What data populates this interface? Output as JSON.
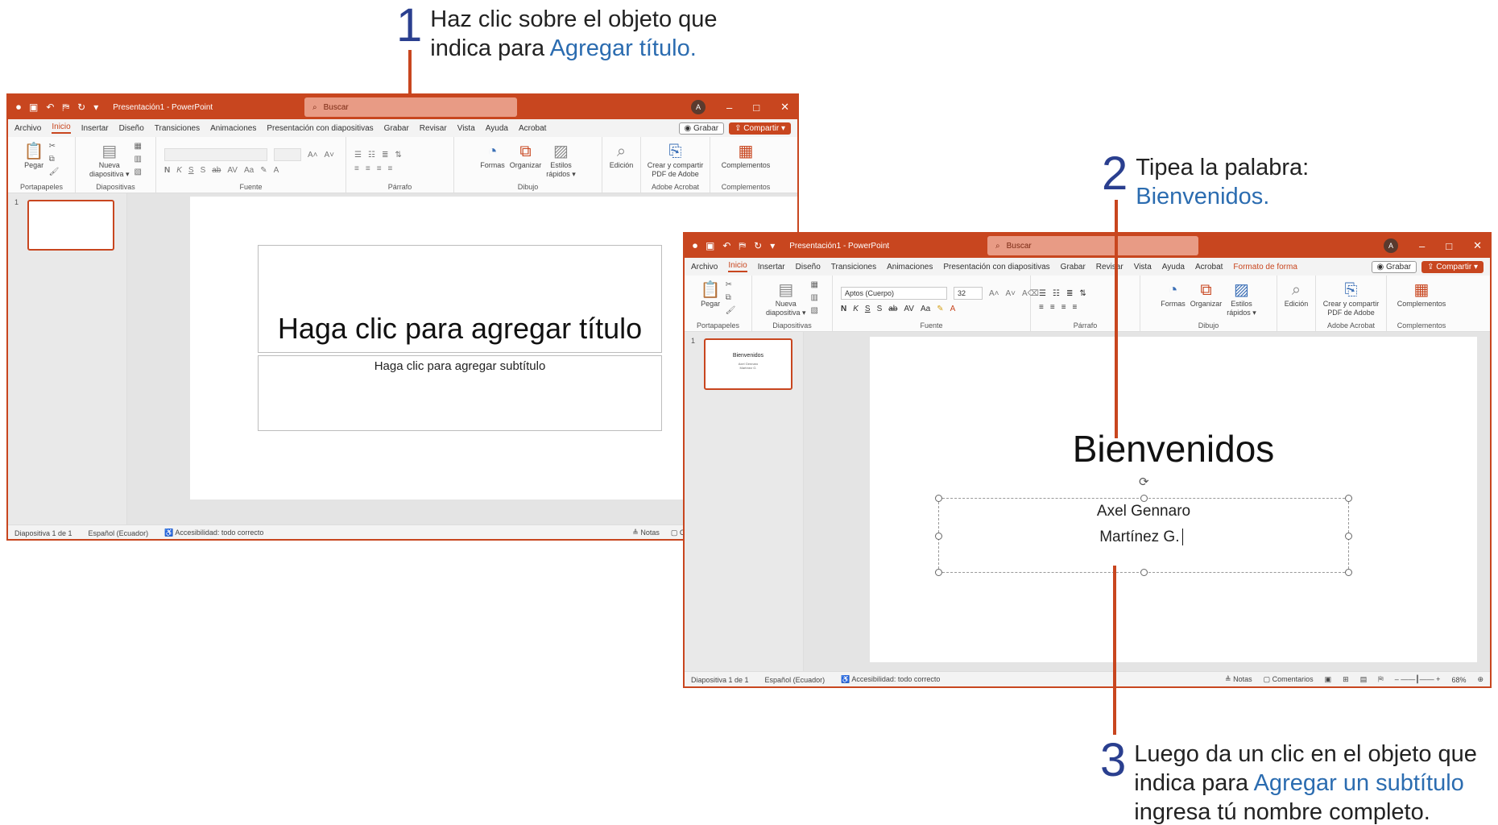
{
  "steps": {
    "s1": {
      "num": "1",
      "line1": "Haz clic sobre el objeto que",
      "line2_pre": "indica para ",
      "line2_hl": "Agregar título."
    },
    "s2": {
      "num": "2",
      "line1": "Tipea la palabra:",
      "line2_hl": "Bienvenidos."
    },
    "s3": {
      "num": "3",
      "line1": "Luego da un clic en el objeto que",
      "line2_pre": "indica para ",
      "line2_hl": "Agregar un subtítulo",
      "line3": "ingresa tú nombre completo."
    }
  },
  "app": {
    "title": "Presentación1 - PowerPoint",
    "search_placeholder": "Buscar",
    "avatar": "A",
    "minimize": "–",
    "maximize": "□",
    "close": "✕"
  },
  "tabs": [
    "Archivo",
    "Inicio",
    "Insertar",
    "Diseño",
    "Transiciones",
    "Animaciones",
    "Presentación con diapositivas",
    "Grabar",
    "Revisar",
    "Vista",
    "Ayuda",
    "Acrobat"
  ],
  "tab_active": "Inicio",
  "tab_extra": "Formato de forma",
  "record_label": "◉ Grabar",
  "share_label": "⇪ Compartir ▾",
  "ribbon": {
    "paste": "Pegar",
    "new_slide_1": "Nueva",
    "new_slide_2": "diapositiva ▾",
    "shapes": "Formas",
    "arrange": "Organizar",
    "quick_styles_1": "Estilos",
    "quick_styles_2": "rápidos ▾",
    "editing": "Edición",
    "acrobat_1": "Crear y compartir",
    "acrobat_2": "PDF de Adobe",
    "addins": "Complementos",
    "font_name": "Aptos (Cuerpo)",
    "font_size": "32",
    "groups": {
      "clipboard": "Portapapeles",
      "slides": "Diapositivas",
      "font": "Fuente",
      "paragraph": "Párrafo",
      "drawing": "Dibujo",
      "adobe": "Adobe Acrobat",
      "addins": "Complementos"
    }
  },
  "slide_number": "1",
  "slide1": {
    "title_placeholder": "Haga clic para agregar título",
    "subtitle_placeholder": "Haga clic para agregar subtítulo"
  },
  "slide2": {
    "title": "Bienvenidos",
    "subtitle_line1": "Axel Gennaro",
    "subtitle_line2": "Martínez G.",
    "thumb_title": "Bienvenidos",
    "thumb_sub": "Axel Gennaro Martínez G."
  },
  "status": {
    "slide": "Diapositiva 1 de 1",
    "language": "Español (Ecuador)",
    "accessibility": "Accesibilidad: todo correcto",
    "notes": "≜ Notas",
    "comments": "▢ Comentarios",
    "zoom": "68%"
  },
  "colors": {
    "accent": "#c8461f",
    "highlight": "#2b6cb0",
    "step_number": "#2a3f8f"
  }
}
